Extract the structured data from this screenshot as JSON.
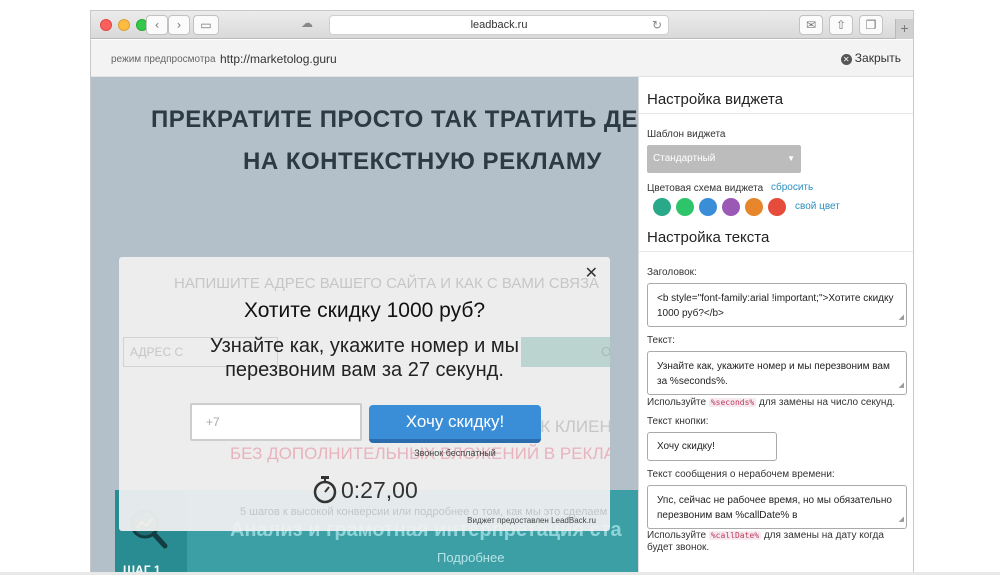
{
  "browser": {
    "url": "leadback.ru",
    "back_icon": "chevron-left-icon",
    "forward_icon": "chevron-right-icon",
    "sidebar_icon": "sidebar-icon",
    "reload_icon": "reload-icon",
    "share_icon": "share-icon",
    "tabs_icon": "tabs-icon",
    "mail_icon": "mail-icon",
    "new_tab_label": "+"
  },
  "preview_bar": {
    "label": "режим предпросмотра",
    "url": "http://marketolog.guru",
    "close_label": "Закрыть"
  },
  "page": {
    "headline_line1": "ПРЕКРАТИТЕ ПРОСТО ТАК ТРАТИТЬ ДЕ",
    "headline_line2": "НА КОНТЕКСТНУЮ РЕКЛАМУ",
    "ghost_subtitle": "НАПИШИТЕ АДРЕС ВАШЕГО САЙТА И КАК С ВАМИ СВЯЗА",
    "ghost_input": "АДРЕС С",
    "ghost_button": "ОТПРА",
    "ghost_clients": "ОК КЛИЕНТО",
    "ghost_no_ads": "БЕЗ ДОПОЛНИТЕЛЬНЫХ ВЛОЖЕНИЙ В РЕКЛАМУ",
    "ghost_steps": "5 шагов к высокой конверсии или подробнее о том, как мы это сделаем",
    "step_title": "Анализ и грамотная интерпретация ста",
    "step_more": "Подробнее",
    "step_num": "ШАГ 1"
  },
  "popup": {
    "title": "Хотите скидку 1000 руб?",
    "text_line1": "Узнайте как, укажите номер и мы",
    "text_line2": "перезвоним вам за 27 секунд.",
    "phone_placeholder": "+7",
    "button_label": "Хочу скидку!",
    "free_call": "Звонок бесплатный",
    "timer": "0:27,00",
    "provided_by": "Виджет предоставлен LeadBack.ru"
  },
  "panel": {
    "widget_settings_title": "Настройка виджета",
    "template_label": "Шаблон виджета",
    "template_value": "Стандартный",
    "color_scheme_label": "Цветовая схема виджета",
    "reset_label": "сбросить",
    "own_color_label": "свой цвет",
    "swatches": [
      "#2aa88a",
      "#2ec46a",
      "#3a8ed8",
      "#9b59b6",
      "#e6852a",
      "#e64c3c"
    ],
    "text_settings_title": "Настройка текста",
    "heading_label": "Заголовок:",
    "heading_value": "<b style=\"font-family:arial !important;\">Хотите скидку 1000 руб?</b>",
    "text_label": "Текст:",
    "text_value": "Узнайте как, укажите номер и мы перезвоним вам за %seconds%.",
    "seconds_hint_pre": "Используйте",
    "seconds_code": "%seconds%",
    "seconds_hint_post": "для замены на число секунд.",
    "button_text_label": "Текст кнопки:",
    "button_text_value": "Хочу скидку!",
    "offhours_label": "Текст сообщения о нерабочем времени:",
    "offhours_value": "Упс, сейчас не рабочее время, но мы обязательно перезвоним вам %callDate% в",
    "calldate_hint_pre": "Используйте",
    "calldate_code": "%callDate%",
    "calldate_hint_post": "для замены на дату когда",
    "calldate_hint_line2": "будет звонок."
  }
}
